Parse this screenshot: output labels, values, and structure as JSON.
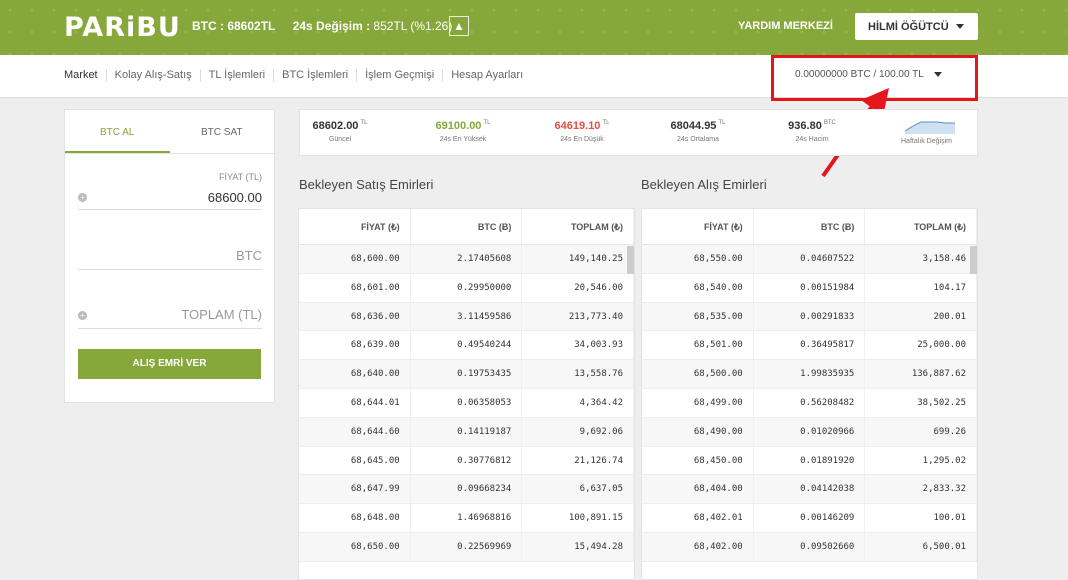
{
  "header": {
    "logo": "PARiBU",
    "btc_price": "BTC : 68602TL",
    "change_label": "24s Değişim : ",
    "change_value": "852TL (%1.26)",
    "help": "YARDIM MERKEZİ",
    "user": "HİLMİ ÖĞÜTCÜ"
  },
  "nav": {
    "items": [
      "Market",
      "Kolay Alış-Satış",
      "TL İşlemleri",
      "BTC İşlemleri",
      "İşlem Geçmişi",
      "Hesap Ayarları"
    ],
    "balance": "0.00000000 BTC / 100.00 TL"
  },
  "panel": {
    "tab_buy": "BTC AL",
    "tab_sell": "BTC SAT",
    "price_label": "FİYAT (TL)",
    "price_value": "68600.00",
    "btc_placeholder": "BTC",
    "total_placeholder": "TOPLAM (TL)",
    "order_button": "ALIŞ EMRİ VER"
  },
  "stats": [
    {
      "value": "68602.00",
      "unit": "TL",
      "label": "Güncel"
    },
    {
      "value": "69100.00",
      "unit": "TL",
      "label": "24s En Yüksek"
    },
    {
      "value": "64619.10",
      "unit": "TL",
      "label": "24s En Düşük"
    },
    {
      "value": "68044.95",
      "unit": "TL",
      "label": "24s Ortalama"
    },
    {
      "value": "936.80",
      "unit": "BTC",
      "label": "24s Hacim"
    }
  ],
  "weekly_label": "Haftalık Değişim",
  "sell_book": {
    "title": "Bekleyen Satış Emirleri",
    "headers": [
      "FİYAT (₺)",
      "BTC (Ƀ)",
      "TOPLAM (₺)"
    ],
    "rows": [
      [
        "68,600.00",
        "2.17405608",
        "149,140.25"
      ],
      [
        "68,601.00",
        "0.29950000",
        "20,546.00"
      ],
      [
        "68,636.00",
        "3.11459586",
        "213,773.40"
      ],
      [
        "68,639.00",
        "0.49540244",
        "34,003.93"
      ],
      [
        "68,640.00",
        "0.19753435",
        "13,558.76"
      ],
      [
        "68,644.01",
        "0.06358053",
        "4,364.42"
      ],
      [
        "68,644.60",
        "0.14119187",
        "9,692.06"
      ],
      [
        "68,645.00",
        "0.30776812",
        "21,126.74"
      ],
      [
        "68,647.99",
        "0.09668234",
        "6,637.05"
      ],
      [
        "68,648.00",
        "1.46968816",
        "100,891.15"
      ],
      [
        "68,650.00",
        "0.22569969",
        "15,494.28"
      ]
    ]
  },
  "buy_book": {
    "title": "Bekleyen Alış Emirleri",
    "headers": [
      "FİYAT (₺)",
      "BTC (Ƀ)",
      "TOPLAM (₺)"
    ],
    "rows": [
      [
        "68,550.00",
        "0.04607522",
        "3,158.46"
      ],
      [
        "68,540.00",
        "0.00151984",
        "104.17"
      ],
      [
        "68,535.00",
        "0.00291833",
        "200.01"
      ],
      [
        "68,501.00",
        "0.36495817",
        "25,000.00"
      ],
      [
        "68,500.00",
        "1.99835935",
        "136,887.62"
      ],
      [
        "68,499.00",
        "0.56208482",
        "38,502.25"
      ],
      [
        "68,490.00",
        "0.01020966",
        "699.26"
      ],
      [
        "68,450.00",
        "0.01891920",
        "1,295.02"
      ],
      [
        "68,404.00",
        "0.04142038",
        "2,833.32"
      ],
      [
        "68,402.01",
        "0.00146209",
        "100.01"
      ],
      [
        "68,402.00",
        "0.09502660",
        "6,500.01"
      ]
    ]
  },
  "colors": {
    "brand": "#86a83a",
    "low": "#e3503d",
    "highlight_box": "#e5161b"
  }
}
